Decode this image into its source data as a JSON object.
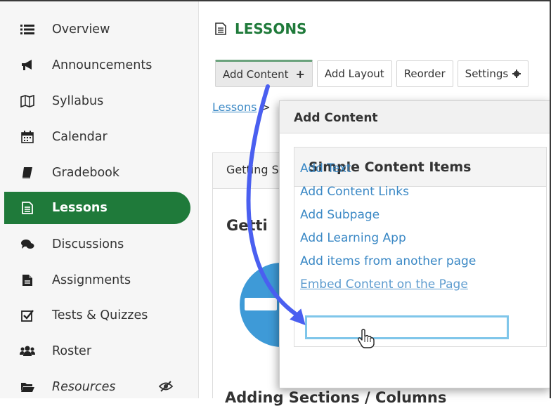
{
  "sidebar": {
    "items": [
      {
        "label": "Overview",
        "icon": "list-icon"
      },
      {
        "label": "Announcements",
        "icon": "megaphone-icon"
      },
      {
        "label": "Syllabus",
        "icon": "map-icon"
      },
      {
        "label": "Calendar",
        "icon": "calendar-icon"
      },
      {
        "label": "Gradebook",
        "icon": "book-icon"
      },
      {
        "label": "Lessons",
        "icon": "document-icon",
        "active": true
      },
      {
        "label": "Discussions",
        "icon": "chat-icon"
      },
      {
        "label": "Assignments",
        "icon": "file-icon"
      },
      {
        "label": "Tests & Quizzes",
        "icon": "checkbox-icon"
      },
      {
        "label": "Roster",
        "icon": "users-icon"
      },
      {
        "label": "Resources",
        "icon": "folder-icon",
        "hidden_icon": "eye-slash-icon"
      }
    ]
  },
  "header": {
    "title": "LESSONS"
  },
  "toolbar": {
    "add_content": "Add Content",
    "add_content_icon": "+",
    "add_layout": "Add Layout",
    "reorder": "Reorder",
    "settings": "Settings"
  },
  "breadcrumb": {
    "link": "Lessons",
    "separator": ">"
  },
  "background": {
    "tab_label": "Getting S",
    "heading": "Getti",
    "bottom_heading": "Adding Sections / Columns"
  },
  "popup": {
    "title": "Add Content",
    "card_title": "Simple Content Items",
    "links": [
      "Add Text",
      "Add Content Links",
      "Add Subpage",
      "Add Learning App",
      "Add items from another page",
      "Embed Content on the Page"
    ]
  },
  "colors": {
    "accent_green": "#1f7a3a",
    "link_blue": "#3a88c5",
    "arrow_blue": "#4a5ff0",
    "highlight": "#7fc6ea"
  }
}
